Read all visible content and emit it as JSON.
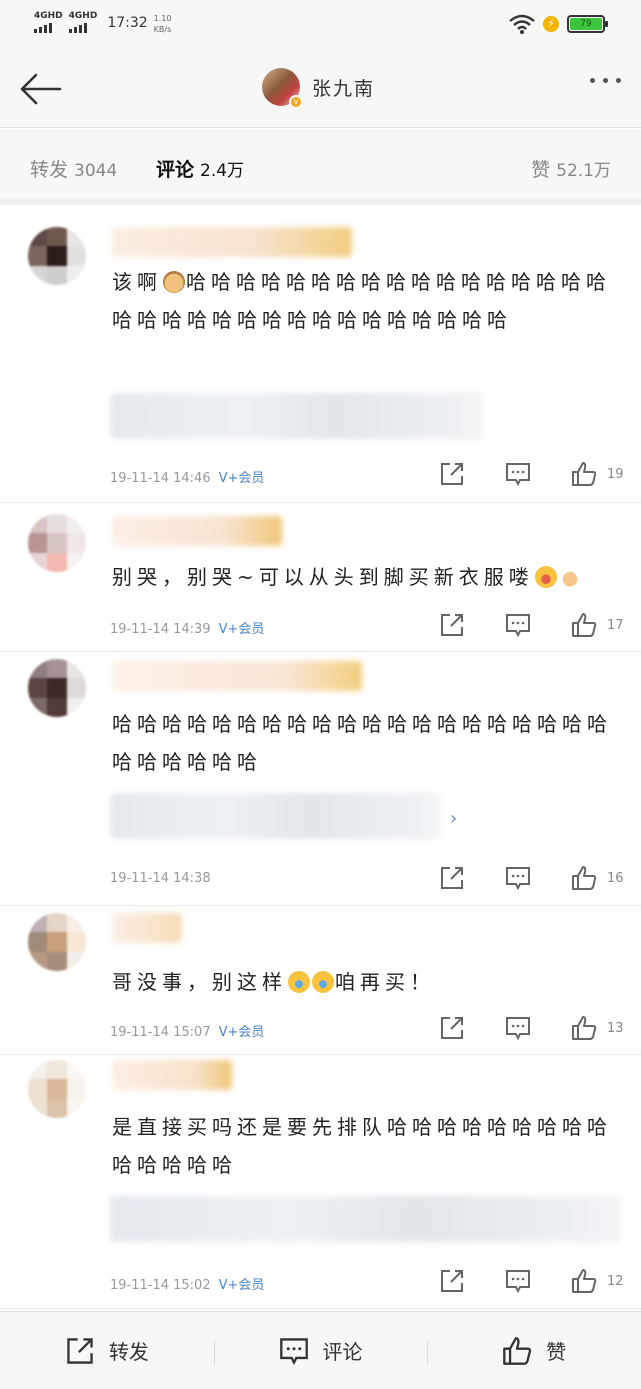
{
  "status": {
    "net1": "4GHD",
    "net2": "4GHD",
    "time": "17:32",
    "speed_value": "1.10",
    "speed_unit": "KB/s",
    "battery": "79",
    "battery_color": "#3cc63c"
  },
  "nav": {
    "back_icon": "arrow-left-icon",
    "user_name": "张九南",
    "more_icon": "more-dots-icon"
  },
  "tabs": {
    "repost_label": "转发",
    "repost_count": "3044",
    "comment_label": "评论",
    "comment_count": "2.4万",
    "like_label": "赞",
    "like_count": "52.1万"
  },
  "comments": [
    {
      "text": "该啊",
      "text_after": "哈哈哈哈哈哈哈哈哈哈哈哈哈哈哈哈哈哈哈哈哈哈哈哈哈哈哈哈哈哈哈哈哈",
      "time": "19-11-14 14:46",
      "vip": "V+会员",
      "likes": "19"
    },
    {
      "text": "别哭，别哭~可以从头到脚买新衣服喽",
      "time": "19-11-14 14:39",
      "vip": "V+会员",
      "likes": "17"
    },
    {
      "text": "哈哈哈哈哈哈哈哈哈哈哈哈哈哈哈哈哈哈哈哈哈哈哈哈哈哈",
      "time": "19-11-14 14:38",
      "vip": "",
      "likes": "16"
    },
    {
      "text": "哥没事，别这样",
      "text_after": "咱再买！",
      "time": "19-11-14 15:07",
      "vip": "V+会员",
      "likes": "13"
    },
    {
      "text": "是直接买吗还是要先排队哈哈哈哈哈哈哈哈哈哈哈哈哈哈",
      "time": "19-11-14 15:02",
      "vip": "V+会员",
      "likes": "12"
    }
  ],
  "bottom": {
    "repost": "转发",
    "comment": "评论",
    "like": "赞"
  },
  "colors": {
    "vip": "#4a84c8",
    "badge": "#f5a623"
  }
}
